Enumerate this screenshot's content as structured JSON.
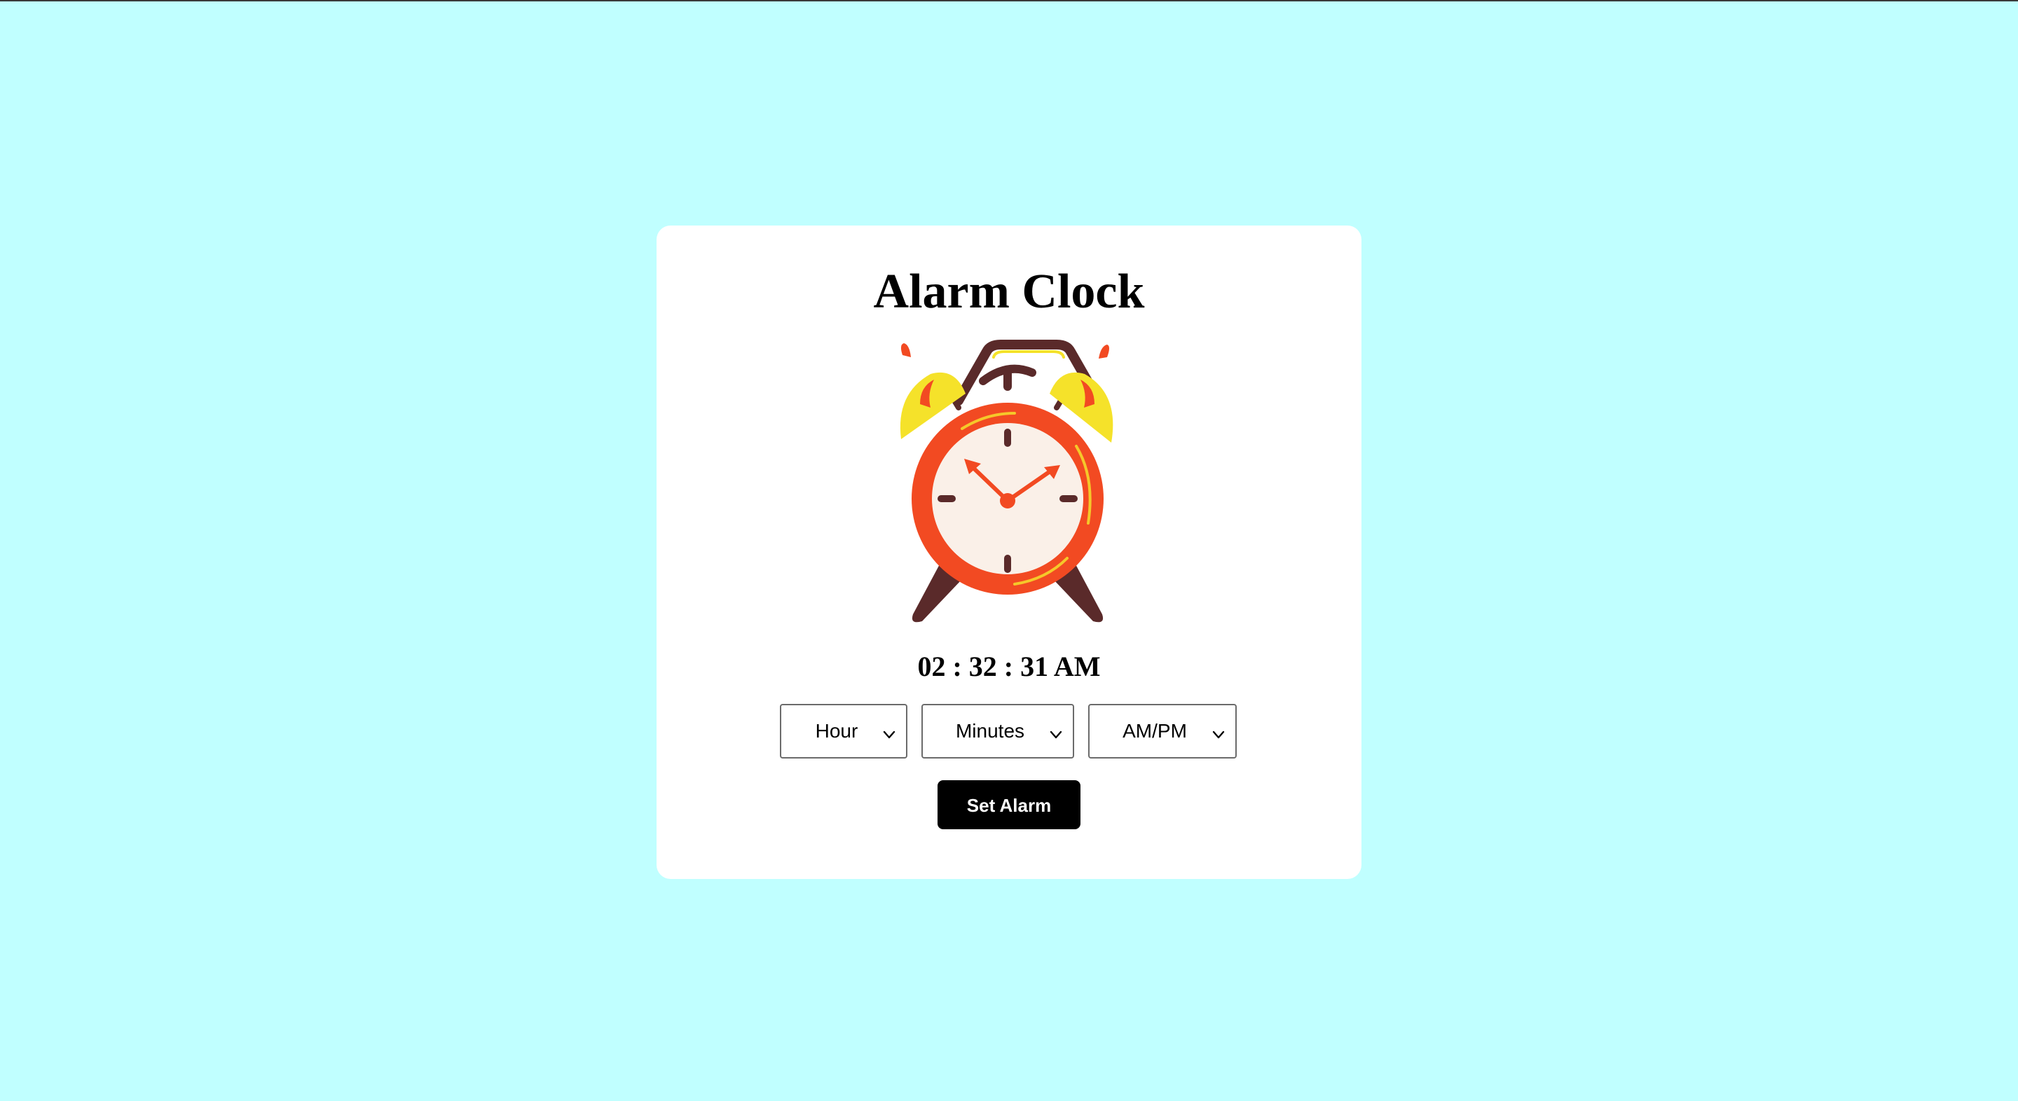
{
  "app": {
    "title": "Alarm Clock",
    "background_color": "#c0ffff",
    "card_color": "#ffffff"
  },
  "clock_image": {
    "icon": "alarm-clock-icon",
    "colors": {
      "body": "#f24a22",
      "face": "#faf0e8",
      "bells": "#f5e22a",
      "frame": "#5a2a2a",
      "hands": "#f24a22",
      "accent_lines": "#f5c82a"
    }
  },
  "current_time": {
    "display": "02 : 32 : 31 AM"
  },
  "controls": {
    "hour": {
      "selected": "Hour",
      "icon": "chevron-down-icon"
    },
    "minutes": {
      "selected": "Minutes",
      "icon": "chevron-down-icon"
    },
    "ampm": {
      "selected": "AM/PM",
      "icon": "chevron-down-icon"
    }
  },
  "set_button": {
    "label": "Set Alarm",
    "color": "#000000",
    "text_color": "#ffffff"
  }
}
